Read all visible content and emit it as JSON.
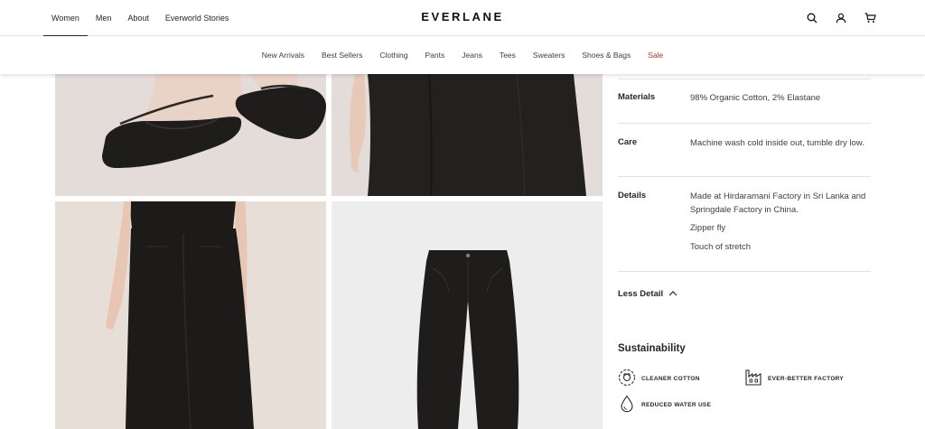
{
  "header": {
    "nav": [
      "Women",
      "Men",
      "About",
      "Everworld Stories"
    ],
    "logo": "EVERLANE",
    "icons": [
      "search-icon",
      "account-icon",
      "cart-icon"
    ]
  },
  "subnav": {
    "items": [
      "New Arrivals",
      "Best Sellers",
      "Clothing",
      "Pants",
      "Jeans",
      "Tees",
      "Sweaters",
      "Shoes & Bags"
    ],
    "sale": "Sale"
  },
  "gallery": {
    "images": [
      "shoes-photo",
      "pants-closeup-photo",
      "pants-back-photo",
      "pants-flat-photo"
    ]
  },
  "details": {
    "materials": {
      "label": "Materials",
      "value": "98% Organic Cotton, 2% Elastane"
    },
    "care": {
      "label": "Care",
      "value": "Machine wash cold inside out, tumble dry low."
    },
    "details": {
      "label": "Details",
      "values": [
        "Made at Hirdaramani Factory in Sri Lanka and Springdale Factory in China.",
        "Zipper fly",
        "Touch of stretch"
      ]
    },
    "less_detail": "Less Detail"
  },
  "sustainability": {
    "title": "Sustainability",
    "badges": [
      "CLEANER COTTON",
      "EVER-BETTER FACTORY",
      "REDUCED WATER USE"
    ]
  },
  "colors": {
    "text": "#262626",
    "sale": "#c4302b",
    "divider": "#e3e3e3"
  }
}
